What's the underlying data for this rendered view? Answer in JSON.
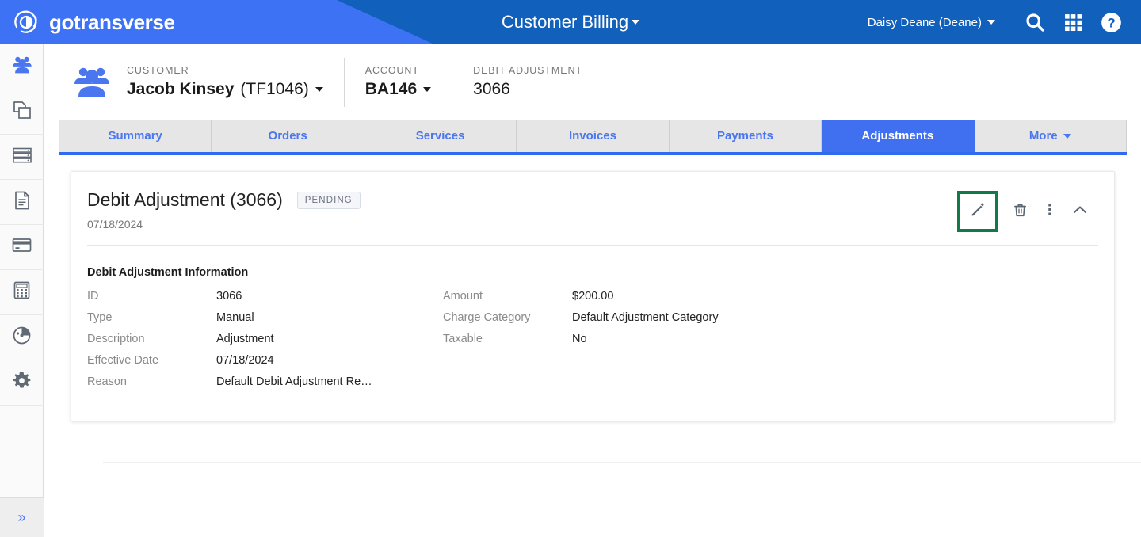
{
  "topbar": {
    "brand_name": "gotransverse",
    "brand_logo_icon": "gotransverse-circle-logo",
    "app_title": "Customer Billing",
    "app_title_caret_icon": "caret-down-icon",
    "user_name": "Daisy Deane (Deane)",
    "user_caret_icon": "caret-down-icon",
    "search_icon": "search-icon",
    "apps_icon": "apps-grid-icon",
    "help_icon": "help-circle-icon",
    "colors": {
      "dark_blue": "#1160bb",
      "light_blue": "#3d72f5"
    }
  },
  "rail": {
    "items": [
      {
        "icon": "customers-people-icon",
        "active": true
      },
      {
        "icon": "copy-documents-icon",
        "active": false
      },
      {
        "icon": "server-stack-icon",
        "active": false
      },
      {
        "icon": "document-file-icon",
        "active": false
      },
      {
        "icon": "credit-card-icon",
        "active": false
      },
      {
        "icon": "calculator-icon",
        "active": false
      },
      {
        "icon": "gauge-dashboard-icon",
        "active": false
      },
      {
        "icon": "gear-settings-icon",
        "active": false
      }
    ],
    "expand_label": "»",
    "expand_icon": "chevron-double-right-icon"
  },
  "context": {
    "avatar_icon": "customer-group-icon",
    "items": [
      {
        "label": "CUSTOMER",
        "value_bold": "Jacob Kinsey",
        "value_regular": "(TF1046)",
        "has_caret": true
      },
      {
        "label": "ACCOUNT",
        "value_bold": "BA146",
        "value_regular": "",
        "has_caret": true
      },
      {
        "label": "DEBIT ADJUSTMENT",
        "value_bold": "",
        "value_regular": "3066",
        "has_caret": false
      }
    ]
  },
  "tabs": {
    "items": [
      {
        "label": "Summary",
        "active": false
      },
      {
        "label": "Orders",
        "active": false
      },
      {
        "label": "Services",
        "active": false
      },
      {
        "label": "Invoices",
        "active": false
      },
      {
        "label": "Payments",
        "active": false
      },
      {
        "label": "Adjustments",
        "active": true
      },
      {
        "label": "More",
        "active": false,
        "caret": true
      }
    ],
    "active_color": "#4070f0",
    "link_color": "#4a76f0"
  },
  "card": {
    "title": "Debit Adjustment (3066)",
    "status_badge": "PENDING",
    "date": "07/18/2024",
    "actions": {
      "edit_icon": "pencil-edit-icon",
      "delete_icon": "trash-delete-icon",
      "more_icon": "dots-vertical-more-icon",
      "collapse_icon": "chevron-up-collapse-icon",
      "highlight_color": "#13794a"
    },
    "section_title": "Debit Adjustment Information",
    "fields_left": [
      {
        "label": "ID",
        "value": "3066"
      },
      {
        "label": "Type",
        "value": "Manual"
      },
      {
        "label": "Description",
        "value": "Adjustment"
      },
      {
        "label": "Effective Date",
        "value": "07/18/2024"
      },
      {
        "label": "Reason",
        "value": "Default Debit Adjustment Re…"
      }
    ],
    "fields_right": [
      {
        "label": "Amount",
        "value": "$200.00"
      },
      {
        "label": "Charge Category",
        "value": "Default Adjustment Category"
      },
      {
        "label": "Taxable",
        "value": "No"
      }
    ]
  }
}
